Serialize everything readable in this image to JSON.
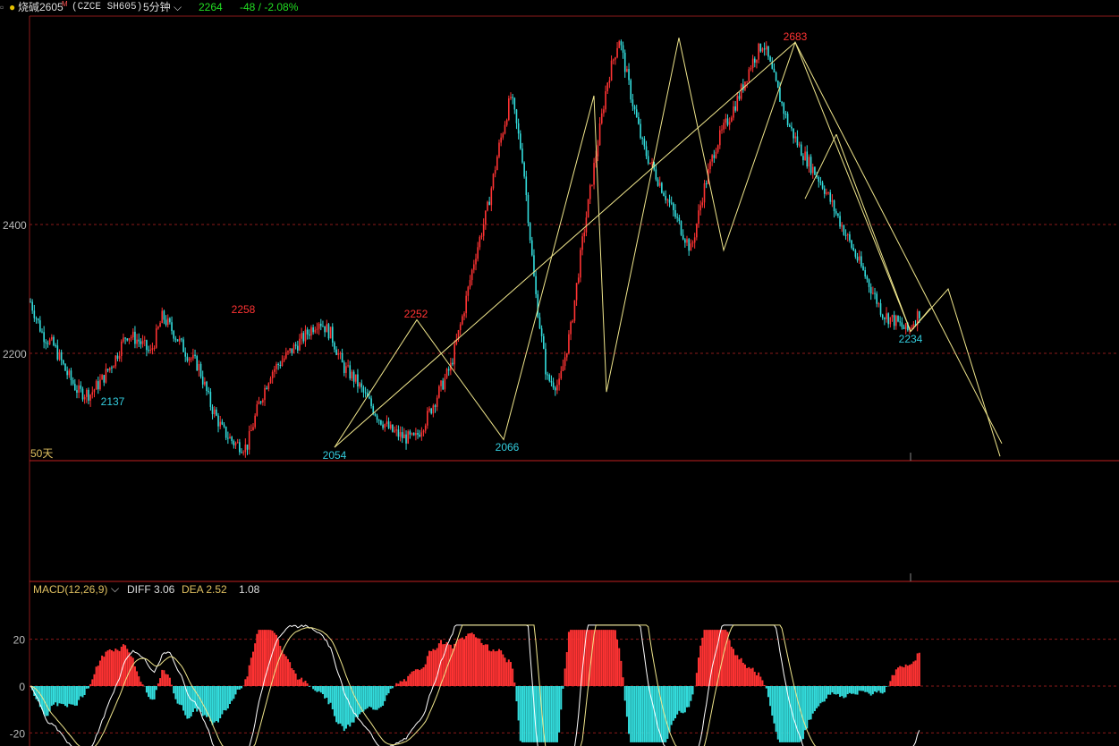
{
  "header": {
    "symbol": "烧碱2605",
    "symbol_flag": "M",
    "exchange_code": "(CZCE SH605)",
    "period": "5分钟",
    "last_price": "2264",
    "change": "-48 / -2.08%"
  },
  "main_panel": {
    "ma_label": "50天",
    "y_ticks": [
      {
        "value": 2400,
        "label": "2400"
      },
      {
        "value": 2200,
        "label": "2200"
      }
    ],
    "price_range": [
      2035,
      2720
    ],
    "pivots": [
      {
        "label": "2137",
        "kind": "low"
      },
      {
        "label": "2258",
        "kind": "high"
      },
      {
        "label": "2054",
        "kind": "low"
      },
      {
        "label": "2252",
        "kind": "high"
      },
      {
        "label": "2066",
        "kind": "low"
      },
      {
        "label": "2683",
        "kind": "high"
      },
      {
        "label": "2234",
        "kind": "low"
      }
    ]
  },
  "macd_panel": {
    "title": "MACD(12,26,9)",
    "diff": "DIFF 3.06",
    "dea": "DEA 2.52",
    "macd": "1.08",
    "y_ticks": [
      {
        "value": 20,
        "label": "20"
      },
      {
        "value": 0,
        "label": "0"
      },
      {
        "value": -20,
        "label": "-20"
      }
    ]
  },
  "colors": {
    "up": "#ff3333",
    "down": "#33dddd",
    "line": "#f0e68c",
    "grid": "#8b1a1a",
    "high_label": "#ff3333",
    "low_label": "#33ccdd"
  },
  "chart_data": [
    {
      "type": "candlestick",
      "title": "",
      "ylim": [
        2035,
        2720
      ],
      "y_ticks": [
        2200,
        2400
      ],
      "pivot_values": [
        2137,
        2258,
        2054,
        2252,
        2066,
        2683,
        2234
      ],
      "wave_path": [
        2054,
        2252,
        2066,
        2600,
        2140,
        2690,
        2360,
        2683,
        2234,
        2300,
        2040
      ],
      "trend_line": {
        "from": 2054,
        "to": 2683
      },
      "close_trace": [
        2280,
        2230,
        2210,
        2170,
        2140,
        2137,
        2160,
        2190,
        2230,
        2220,
        2200,
        2258,
        2230,
        2200,
        2180,
        2120,
        2080,
        2060,
        2054,
        2120,
        2170,
        2190,
        2210,
        2230,
        2252,
        2230,
        2180,
        2160,
        2130,
        2100,
        2080,
        2070,
        2066,
        2100,
        2140,
        2180,
        2260,
        2350,
        2420,
        2520,
        2600,
        2500,
        2300,
        2160,
        2150,
        2240,
        2380,
        2500,
        2620,
        2690,
        2600,
        2520,
        2480,
        2440,
        2400,
        2360,
        2450,
        2520,
        2560,
        2600,
        2650,
        2683,
        2620,
        2560,
        2520,
        2490,
        2460,
        2420,
        2380,
        2340,
        2300,
        2260,
        2250,
        2234,
        2264
      ],
      "grid": true
    },
    {
      "type": "macd",
      "title": "MACD(12,26,9)",
      "ylim": [
        -25,
        25
      ],
      "y_ticks": [
        20,
        0,
        -20
      ],
      "diff": 3.06,
      "dea": 2.52,
      "macd": 1.08
    }
  ]
}
